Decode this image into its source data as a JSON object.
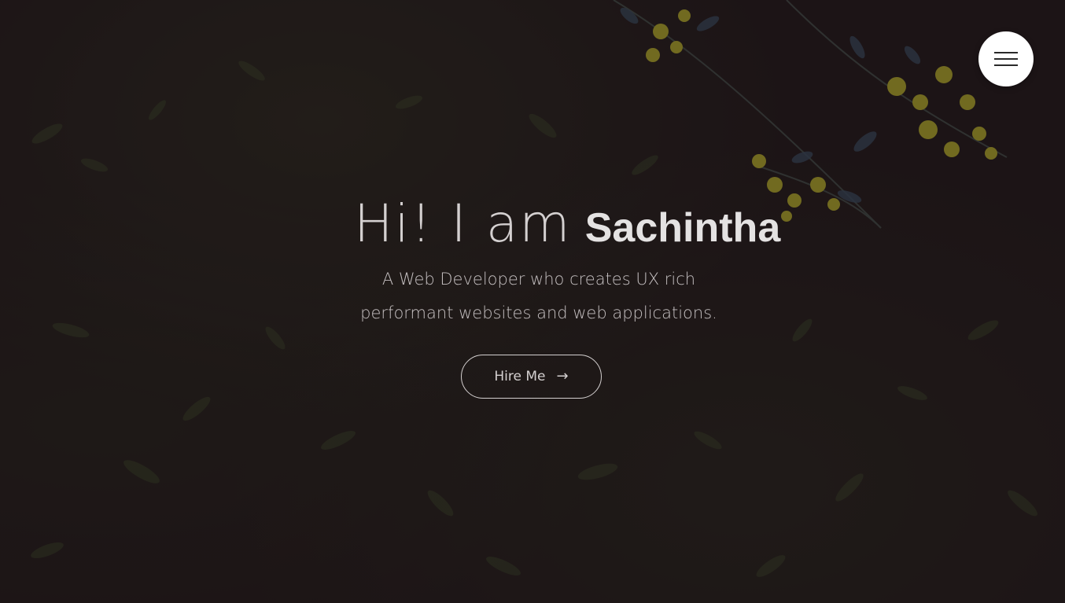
{
  "menu": {
    "icon": "hamburger-menu-icon"
  },
  "hero": {
    "greeting": "Hi! I am",
    "name": "Sachintha",
    "tagline_line1": "A Web Developer who creates UX rich",
    "tagline_line2": "performant websites and web applications.",
    "cta_label": "Hire Me",
    "cta_icon": "arrow-right-icon",
    "cta_glyph": "→"
  },
  "colors": {
    "background": "#1e1719",
    "text": "#d4d0d0",
    "flower_accent": "#c9c52a",
    "menu_bg": "#ffffff"
  }
}
